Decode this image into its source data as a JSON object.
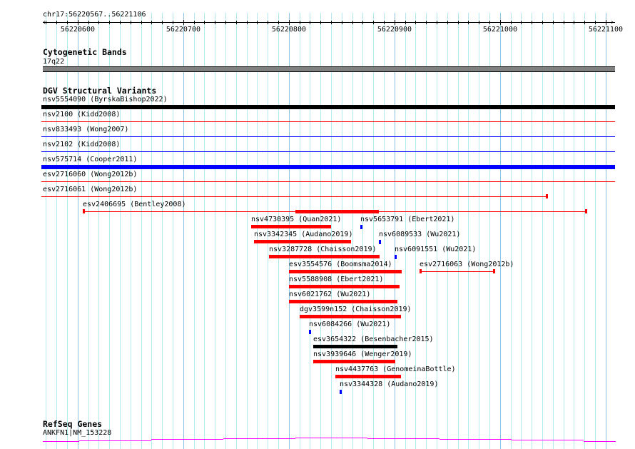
{
  "ruler": {
    "location": "chr17:56220567..56221106",
    "start": 56220567,
    "end": 56221106,
    "labels": [
      "56220600",
      "56220700",
      "56220800",
      "56220900",
      "56221000",
      "56221100"
    ]
  },
  "cytobands": {
    "title": "Cytogenetic Bands",
    "band": "17q22",
    "color": "#808080"
  },
  "dgv": {
    "title": "DGV Structural Variants",
    "features": [
      {
        "label": "nsv5554090 (ByrskaBishop2022)",
        "start": 56220560,
        "end": 56221110,
        "style": "thick",
        "color": "#000000",
        "row": 0
      },
      {
        "label": "nsv2100 (Kidd2008)",
        "start": 56220560,
        "end": 56221110,
        "style": "line",
        "color": "#ff0000",
        "row": 1
      },
      {
        "label": "nsv833493 (Wong2007)",
        "start": 56220560,
        "end": 56221110,
        "style": "line",
        "color": "#0000ff",
        "row": 2
      },
      {
        "label": "nsv2102 (Kidd2008)",
        "start": 56220560,
        "end": 56221110,
        "style": "line",
        "color": "#0000ff",
        "row": 3
      },
      {
        "label": "nsv575714 (Cooper2011)",
        "start": 56220560,
        "end": 56221110,
        "style": "thick",
        "color": "#0000ff",
        "row": 4
      },
      {
        "label": "esv2716060 (Wong2012b)",
        "start": 56220560,
        "end": 56221110,
        "style": "line",
        "color": "#ff0000",
        "row": 5
      },
      {
        "label": "esv2716061 (Wong2012b)",
        "start": 56220560,
        "end": 56221045,
        "style": "capped",
        "color": "#ff0000",
        "row": 6
      },
      {
        "label": "esv2406695 (Bentley2008)",
        "start": 56220605,
        "end": 56221082,
        "style": "capped",
        "color": "#ff0000",
        "row": 7,
        "thick_start": 56220806,
        "thick_end": 56220885
      },
      {
        "label": "nsv4730395 (Quan2021)",
        "start": 56220764,
        "end": 56220840,
        "style": "bar",
        "color": "#ff0000",
        "row": 8
      },
      {
        "label": "nsv5653791 (Ebert2021)",
        "start": 56220868,
        "end": 56220870,
        "style": "small",
        "color": "#0000ff",
        "row": 8
      },
      {
        "label": "nsv3342345 (Audano2019)",
        "start": 56220767,
        "end": 56220859,
        "style": "bar",
        "color": "#ff0000",
        "row": 9
      },
      {
        "label": "nsv6089533 (Wu2021)",
        "start": 56220885,
        "end": 56220887,
        "style": "small",
        "color": "#0000ff",
        "row": 9
      },
      {
        "label": "nsv3287728 (Chaisson2019)",
        "start": 56220781,
        "end": 56220886,
        "style": "bar",
        "color": "#ff0000",
        "row": 10
      },
      {
        "label": "nsv6091551 (Wu2021)",
        "start": 56220900,
        "end": 56220902,
        "style": "small",
        "color": "#0000ff",
        "row": 10
      },
      {
        "label": "esv3554576 (Boomsma2014)",
        "start": 56220800,
        "end": 56220907,
        "style": "bar",
        "color": "#ff0000",
        "row": 11
      },
      {
        "label": "esv2716063 (Wong2012b)",
        "start": 56220924,
        "end": 56220995,
        "style": "capped",
        "color": "#ff0000",
        "row": 11
      },
      {
        "label": "nsv5588908 (Ebert2021)",
        "start": 56220800,
        "end": 56220905,
        "style": "bar",
        "color": "#ff0000",
        "row": 12
      },
      {
        "label": "nsv6021762 (Wu2021)",
        "start": 56220800,
        "end": 56220903,
        "style": "bar",
        "color": "#ff0000",
        "row": 13
      },
      {
        "label": "dgv3599n152 (Chaisson2019)",
        "start": 56220810,
        "end": 56220906,
        "style": "bar",
        "color": "#ff0000",
        "row": 14
      },
      {
        "label": "nsv6084266 (Wu2021)",
        "start": 56220819,
        "end": 56220821,
        "style": "small",
        "color": "#0000ff",
        "row": 15
      },
      {
        "label": "esv3654322 (Besenbacher2015)",
        "start": 56220823,
        "end": 56220903,
        "style": "bar",
        "color": "#000000",
        "row": 16
      },
      {
        "label": "nsv3939646 (Wenger2019)",
        "start": 56220823,
        "end": 56220901,
        "style": "bar",
        "color": "#ff0000",
        "row": 17
      },
      {
        "label": "nsv4437763 (GenomeinaBottle)",
        "start": 56220844,
        "end": 56220906,
        "style": "bar",
        "color": "#ff0000",
        "row": 18
      },
      {
        "label": "nsv3344328 (Audano2019)",
        "start": 56220848,
        "end": 56220850,
        "style": "small",
        "color": "#0000ff",
        "row": 19
      }
    ]
  },
  "refseq": {
    "title": "RefSeq Genes",
    "gene": "ANKFN1|NM_153228",
    "color": "#ff00ff"
  }
}
